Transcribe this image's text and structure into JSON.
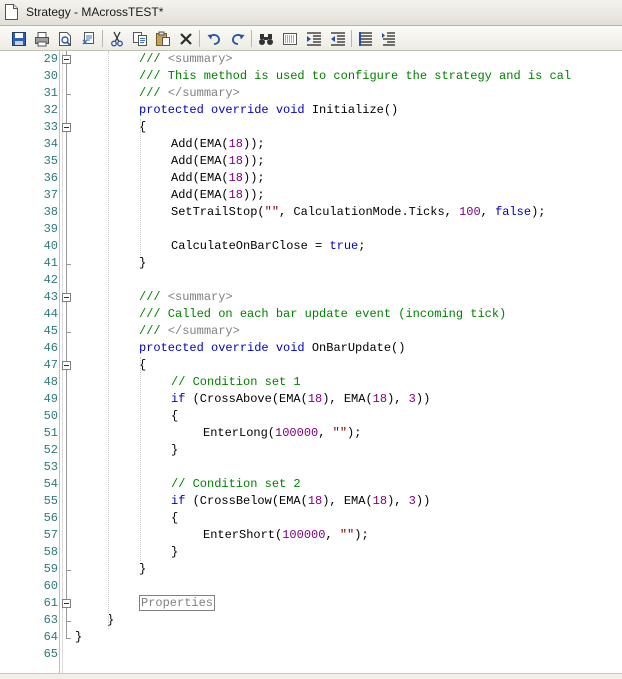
{
  "window": {
    "title": "Strategy - MAcrossTEST*"
  },
  "toolbar": {
    "buttons": [
      {
        "name": "save-button",
        "icon": "floppy-disk-icon"
      },
      {
        "name": "print-button",
        "icon": "printer-icon"
      },
      {
        "name": "print-preview-button",
        "icon": "print-preview-icon"
      },
      {
        "name": "compile-button",
        "icon": "compile-icon"
      },
      {
        "name": "cut-button",
        "icon": "scissors-icon"
      },
      {
        "name": "copy-button",
        "icon": "copy-icon"
      },
      {
        "name": "paste-button",
        "icon": "clipboard-icon"
      },
      {
        "name": "delete-button",
        "icon": "x-icon"
      },
      {
        "name": "undo-button",
        "icon": "undo-arrow-icon"
      },
      {
        "name": "redo-button",
        "icon": "redo-arrow-icon"
      },
      {
        "name": "find-button",
        "icon": "binoculars-icon"
      },
      {
        "name": "replace-button",
        "icon": "replace-icon"
      },
      {
        "name": "indent-button",
        "icon": "indent-icon"
      },
      {
        "name": "outdent-button",
        "icon": "outdent-icon"
      },
      {
        "name": "comment-button",
        "icon": "comment-lines-icon"
      },
      {
        "name": "uncomment-button",
        "icon": "uncomment-lines-icon"
      }
    ]
  },
  "colors": {
    "comment": "#008000",
    "xml_tag": "#808080",
    "keyword": "#0000c0",
    "number": "#800080",
    "string": "#800000",
    "line_number": "#2b7a7a"
  },
  "editor": {
    "lines": [
      {
        "num": "29",
        "indent": 2,
        "tokens": [
          {
            "c": "cm",
            "t": "/// "
          },
          {
            "c": "cg",
            "t": "<summary>"
          }
        ]
      },
      {
        "num": "30",
        "indent": 2,
        "tokens": [
          {
            "c": "cm",
            "t": "/// This method is used to configure the strategy and is cal"
          }
        ]
      },
      {
        "num": "31",
        "indent": 2,
        "tokens": [
          {
            "c": "cm",
            "t": "/// "
          },
          {
            "c": "cg",
            "t": "</summary>"
          }
        ]
      },
      {
        "num": "32",
        "indent": 2,
        "tokens": [
          {
            "c": "kw",
            "t": "protected"
          },
          {
            "c": "",
            "t": " "
          },
          {
            "c": "kw",
            "t": "override"
          },
          {
            "c": "",
            "t": " "
          },
          {
            "c": "kw",
            "t": "void"
          },
          {
            "c": "",
            "t": " Initialize()"
          }
        ]
      },
      {
        "num": "33",
        "indent": 2,
        "tokens": [
          {
            "c": "",
            "t": "{"
          }
        ]
      },
      {
        "num": "34",
        "indent": 3,
        "tokens": [
          {
            "c": "",
            "t": "Add(EMA("
          },
          {
            "c": "nm",
            "t": "18"
          },
          {
            "c": "",
            "t": "));"
          }
        ]
      },
      {
        "num": "35",
        "indent": 3,
        "tokens": [
          {
            "c": "",
            "t": "Add(EMA("
          },
          {
            "c": "nm",
            "t": "18"
          },
          {
            "c": "",
            "t": "));"
          }
        ]
      },
      {
        "num": "36",
        "indent": 3,
        "tokens": [
          {
            "c": "",
            "t": "Add(EMA("
          },
          {
            "c": "nm",
            "t": "18"
          },
          {
            "c": "",
            "t": "));"
          }
        ]
      },
      {
        "num": "37",
        "indent": 3,
        "tokens": [
          {
            "c": "",
            "t": "Add(EMA("
          },
          {
            "c": "nm",
            "t": "18"
          },
          {
            "c": "",
            "t": "));"
          }
        ]
      },
      {
        "num": "38",
        "indent": 3,
        "tokens": [
          {
            "c": "",
            "t": "SetTrailStop("
          },
          {
            "c": "st",
            "t": "\"\""
          },
          {
            "c": "",
            "t": ", CalculationMode.Ticks, "
          },
          {
            "c": "nm",
            "t": "100"
          },
          {
            "c": "",
            "t": ", "
          },
          {
            "c": "kw",
            "t": "false"
          },
          {
            "c": "",
            "t": ");"
          }
        ]
      },
      {
        "num": "39",
        "indent": 3,
        "tokens": []
      },
      {
        "num": "40",
        "indent": 3,
        "tokens": [
          {
            "c": "",
            "t": "CalculateOnBarClose = "
          },
          {
            "c": "kw",
            "t": "true"
          },
          {
            "c": "",
            "t": ";"
          }
        ]
      },
      {
        "num": "41",
        "indent": 2,
        "tokens": [
          {
            "c": "",
            "t": "}"
          }
        ]
      },
      {
        "num": "42",
        "indent": 2,
        "tokens": []
      },
      {
        "num": "43",
        "indent": 2,
        "tokens": [
          {
            "c": "cm",
            "t": "/// "
          },
          {
            "c": "cg",
            "t": "<summary>"
          }
        ]
      },
      {
        "num": "44",
        "indent": 2,
        "tokens": [
          {
            "c": "cm",
            "t": "/// Called on each bar update event (incoming tick)"
          }
        ]
      },
      {
        "num": "45",
        "indent": 2,
        "tokens": [
          {
            "c": "cm",
            "t": "/// "
          },
          {
            "c": "cg",
            "t": "</summary>"
          }
        ]
      },
      {
        "num": "46",
        "indent": 2,
        "tokens": [
          {
            "c": "kw",
            "t": "protected"
          },
          {
            "c": "",
            "t": " "
          },
          {
            "c": "kw",
            "t": "override"
          },
          {
            "c": "",
            "t": " "
          },
          {
            "c": "kw",
            "t": "void"
          },
          {
            "c": "",
            "t": " OnBarUpdate()"
          }
        ]
      },
      {
        "num": "47",
        "indent": 2,
        "tokens": [
          {
            "c": "",
            "t": "{"
          }
        ]
      },
      {
        "num": "48",
        "indent": 3,
        "tokens": [
          {
            "c": "cm",
            "t": "// Condition set 1"
          }
        ]
      },
      {
        "num": "49",
        "indent": 3,
        "tokens": [
          {
            "c": "kw",
            "t": "if"
          },
          {
            "c": "",
            "t": " (CrossAbove(EMA("
          },
          {
            "c": "nm",
            "t": "18"
          },
          {
            "c": "",
            "t": "), EMA("
          },
          {
            "c": "nm",
            "t": "18"
          },
          {
            "c": "",
            "t": "), "
          },
          {
            "c": "nm",
            "t": "3"
          },
          {
            "c": "",
            "t": "))"
          }
        ]
      },
      {
        "num": "50",
        "indent": 3,
        "tokens": [
          {
            "c": "",
            "t": "{"
          }
        ]
      },
      {
        "num": "51",
        "indent": 4,
        "tokens": [
          {
            "c": "",
            "t": "EnterLong("
          },
          {
            "c": "nm",
            "t": "100000"
          },
          {
            "c": "",
            "t": ", "
          },
          {
            "c": "st",
            "t": "\"\""
          },
          {
            "c": "",
            "t": ");"
          }
        ]
      },
      {
        "num": "52",
        "indent": 3,
        "tokens": [
          {
            "c": "",
            "t": "}"
          }
        ]
      },
      {
        "num": "53",
        "indent": 3,
        "tokens": []
      },
      {
        "num": "54",
        "indent": 3,
        "tokens": [
          {
            "c": "cm",
            "t": "// Condition set 2"
          }
        ]
      },
      {
        "num": "55",
        "indent": 3,
        "tokens": [
          {
            "c": "kw",
            "t": "if"
          },
          {
            "c": "",
            "t": " (CrossBelow(EMA("
          },
          {
            "c": "nm",
            "t": "18"
          },
          {
            "c": "",
            "t": "), EMA("
          },
          {
            "c": "nm",
            "t": "18"
          },
          {
            "c": "",
            "t": "), "
          },
          {
            "c": "nm",
            "t": "3"
          },
          {
            "c": "",
            "t": "))"
          }
        ]
      },
      {
        "num": "56",
        "indent": 3,
        "tokens": [
          {
            "c": "",
            "t": "{"
          }
        ]
      },
      {
        "num": "57",
        "indent": 4,
        "tokens": [
          {
            "c": "",
            "t": "EnterShort("
          },
          {
            "c": "nm",
            "t": "100000"
          },
          {
            "c": "",
            "t": ", "
          },
          {
            "c": "st",
            "t": "\"\""
          },
          {
            "c": "",
            "t": ");"
          }
        ]
      },
      {
        "num": "58",
        "indent": 3,
        "tokens": [
          {
            "c": "",
            "t": "}"
          }
        ]
      },
      {
        "num": "59",
        "indent": 2,
        "tokens": [
          {
            "c": "",
            "t": "}"
          }
        ]
      },
      {
        "num": "60",
        "indent": 2,
        "tokens": []
      },
      {
        "num": "61",
        "indent": 2,
        "tokens": [
          {
            "c": "region",
            "t": "Properties"
          }
        ]
      },
      {
        "num": "63",
        "indent": 1,
        "tokens": [
          {
            "c": "",
            "t": "}"
          }
        ]
      },
      {
        "num": "64",
        "indent": 0,
        "tokens": [
          {
            "c": "",
            "t": "}"
          }
        ]
      },
      {
        "num": "65",
        "indent": 0,
        "tokens": []
      }
    ]
  }
}
